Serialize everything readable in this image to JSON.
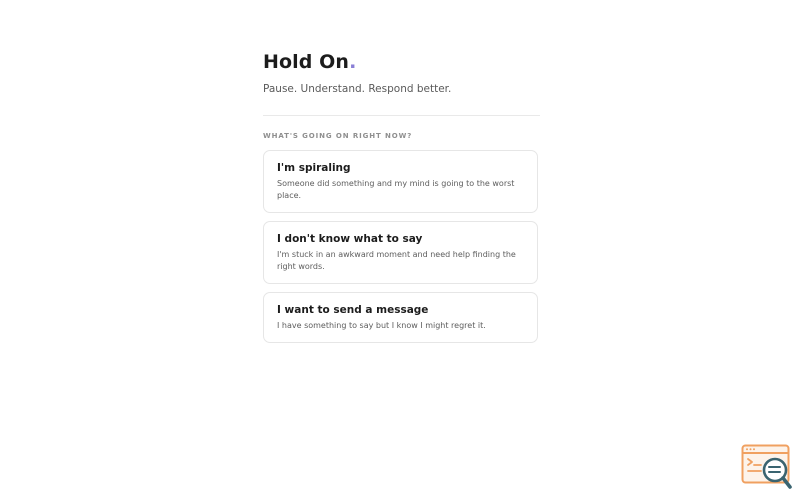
{
  "header": {
    "title": "Hold On",
    "title_dot": ".",
    "subtitle": "Pause. Understand. Respond better."
  },
  "section": {
    "label": "WHAT'S GOING ON RIGHT NOW?"
  },
  "options": [
    {
      "title": "I'm spiraling",
      "description": "Someone did something and my mind is going to the worst place."
    },
    {
      "title": "I don't know what to say",
      "description": "I'm stuck in an awkward moment and need help finding the right words."
    },
    {
      "title": "I want to send a message",
      "description": "I have something to say but I know I might regret it."
    }
  ],
  "colors": {
    "accent_dot": "#8a7fd6",
    "widget_orange": "#f0a060",
    "widget_teal": "#3a6470"
  },
  "widget": {
    "icon": "code-search-icon"
  }
}
